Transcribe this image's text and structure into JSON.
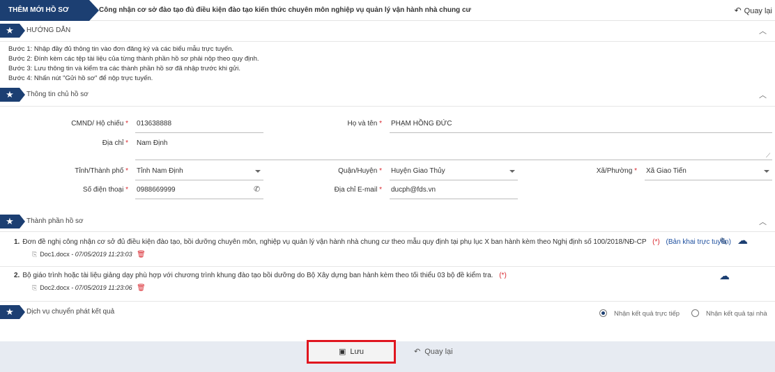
{
  "header": {
    "tag": "THÊM MỚI HỒ SƠ",
    "title": "Công nhận cơ sở đào tạo đủ điều kiện đào tạo kiến thức chuyên môn nghiệp vụ quản lý vận hành nhà chung cư",
    "back_label": "Quay lại"
  },
  "guide": {
    "title": "HƯỚNG DẪN",
    "steps": [
      "Bước 1: Nhập đầy đủ thông tin vào đơn đăng ký và các biểu mẫu trực tuyến.",
      "Bước 2: Đính kèm các tệp tài liệu của từng thành phần hồ sơ phải nộp theo quy định.",
      "Bước 3: Lưu thông tin và kiểm tra các thành phần hồ sơ đã nhập trước khi gửi.",
      "Bước 4: Nhấn nút \"Gửi hồ sơ\" để nộp trực tuyến."
    ]
  },
  "owner": {
    "title": "Thông tin chủ hồ sơ",
    "required_mark": "*",
    "id_label": "CMND/ Hộ chiếu",
    "id_value": "013638888",
    "name_label": "Họ và tên",
    "name_value": "PHẠM HỒNG ĐỨC",
    "address_label": "Địa chỉ",
    "address_value": "Nam Định",
    "province_label": "Tỉnh/Thành phố",
    "province_value": "Tỉnh Nam Định",
    "district_label": "Quận/Huyện",
    "district_value": "Huyện Giao Thủy",
    "ward_label": "Xã/Phường",
    "ward_value": "Xã Giao Tiến",
    "phone_label": "Số điện thoại",
    "phone_value": "0988669999",
    "email_label": "Địa chỉ E-mail",
    "email_value": "ducph@fds.vn"
  },
  "documents": {
    "title": "Thành phần hồ sơ",
    "items": [
      {
        "num": "1.",
        "text": "Đơn đề nghị công nhận cơ sở đủ điều kiện đào tạo, bồi dưỡng chuyên môn, nghiệp vụ quản lý vận hành nhà chung cư theo mẫu quy định tại phụ lục X ban hành kèm theo Nghị định số 100/2018/NĐ-CP",
        "required": "(*)",
        "link": "(Bản khai trực tuyến)",
        "file": "Doc1.docx",
        "date": " - 07/05/2019 11:23:03"
      },
      {
        "num": "2.",
        "text": "Bộ giáo trình hoặc tài liệu giảng dạy phù hợp với chương trình khung đào tạo bồi dưỡng do Bộ Xây dựng ban hành kèm theo tối thiểu 03 bộ đề kiểm tra.",
        "required": "(*)",
        "file": "Doc2.docx",
        "date": " - 07/05/2019 11:23:06"
      }
    ]
  },
  "delivery": {
    "title": "Dịch vụ chuyển phát kết quả",
    "option_direct": "Nhận kết quả trực tiếp",
    "option_home": "Nhận kết quả tại nhà",
    "selected": "Nhận kết quả trực tiếp"
  },
  "footer": {
    "save_label": "Lưu",
    "back_label": "Quay lại"
  },
  "colors": {
    "primary": "#1c3f72",
    "highlight": "#e0161f",
    "required": "#d9272e"
  }
}
